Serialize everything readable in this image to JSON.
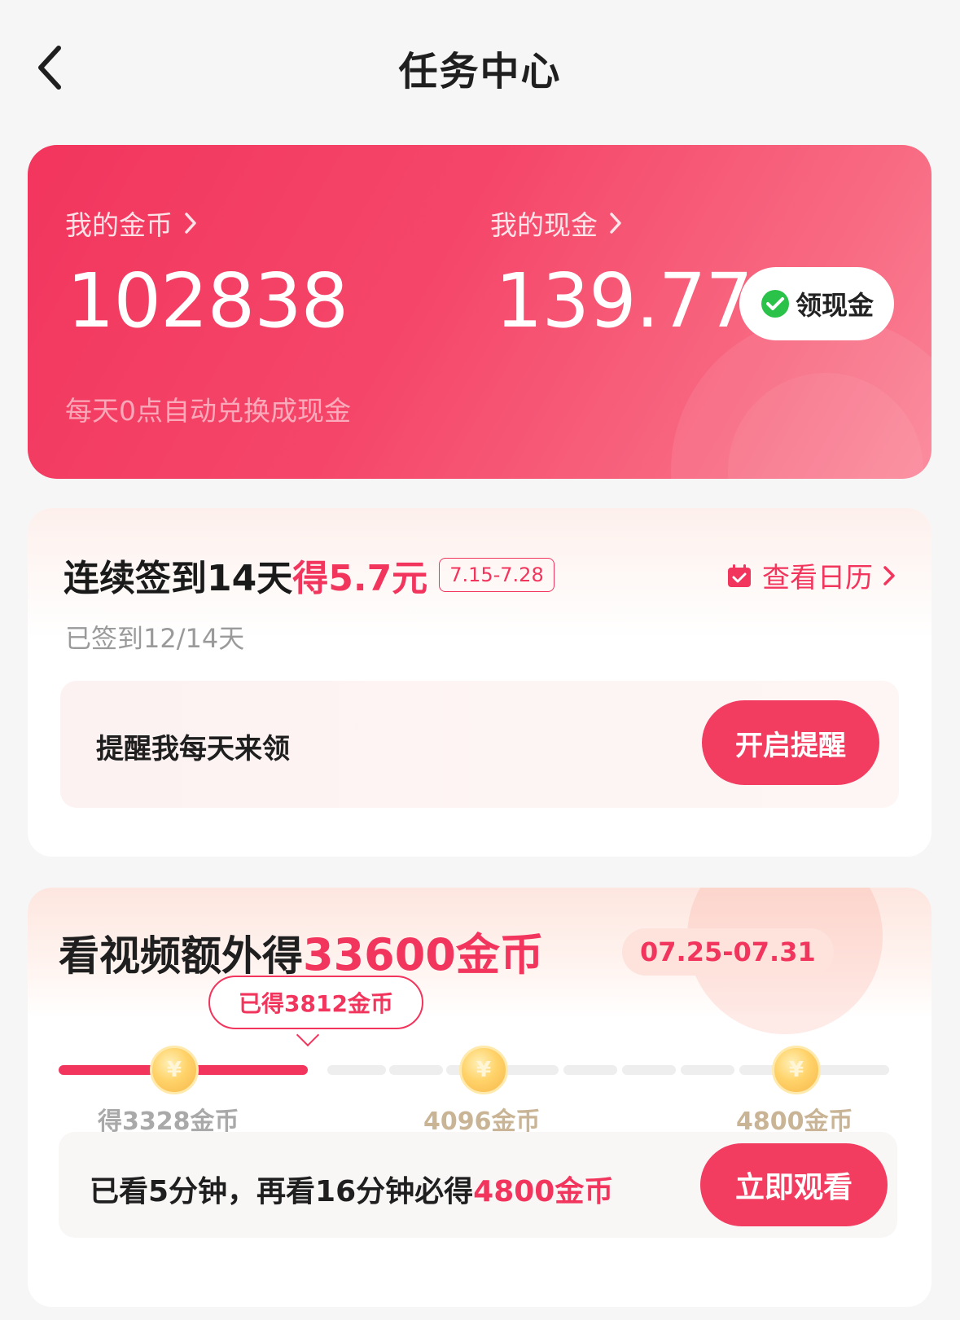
{
  "header": {
    "title": "任务中心"
  },
  "wallet": {
    "coins_label": "我的金币",
    "coins_value": "102838",
    "cash_label": "我的现金",
    "cash_value": "139.77",
    "withdraw_label": "领现金",
    "note": "每天0点自动兑换成现金"
  },
  "checkin": {
    "title_prefix": "连续签到14天",
    "title_reward": "得5.7元",
    "date_range": "7.15-7.28",
    "calendar_label": "查看日历",
    "progress": "已签到12/14天",
    "reminder_text": "提醒我每天来领",
    "reminder_button": "开启提醒"
  },
  "video": {
    "title_prefix": "看视频额外得",
    "title_reward": "33600金币",
    "date_range": "07.25-07.31",
    "earned_bubble": "已得3812金币",
    "progress_fraction": 0.3,
    "milestones": [
      {
        "label": "得3328金币",
        "reached": true
      },
      {
        "label": "4096金币",
        "reached": false
      },
      {
        "label": "4800金币",
        "reached": false
      }
    ],
    "watch_text_prefix": "已看5分钟，再看16分钟必得",
    "watch_text_reward": "4800金币",
    "watch_button": "立即观看"
  },
  "colors": {
    "accent": "#f2355d",
    "wechat_green": "#2bc24a"
  },
  "icons": [
    "back-chevron-icon",
    "wechat-icon",
    "calendar-icon",
    "chevron-right-icon",
    "coin-icon"
  ]
}
